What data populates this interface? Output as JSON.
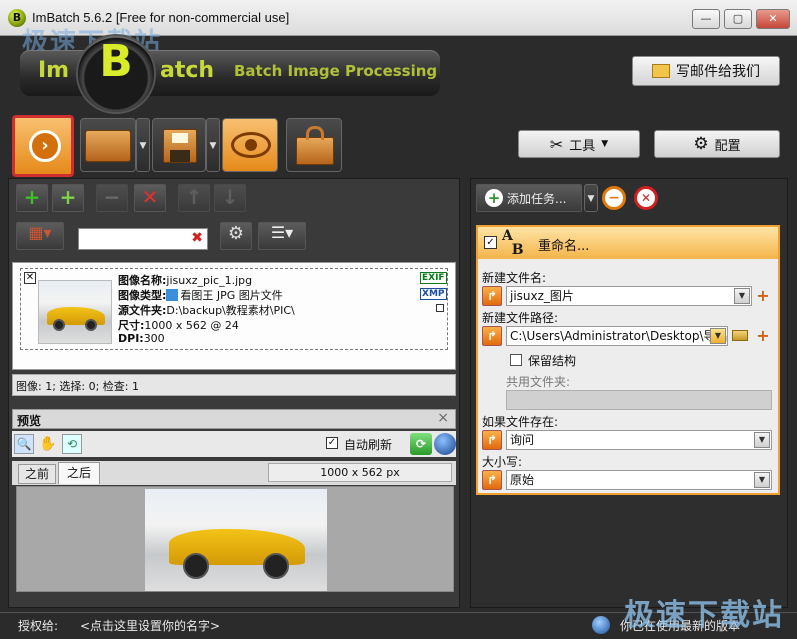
{
  "window": {
    "title": "ImBatch 5.6.2 [Free for non-commercial use]",
    "min": "—",
    "max": "▢",
    "close": "✕"
  },
  "logo": {
    "left": "Im",
    "center": "B",
    "right": "atch",
    "tagline": "Batch Image Processing"
  },
  "header": {
    "email_label": "写邮件给我们"
  },
  "toolbar": {
    "tools_label": "工具",
    "config_label": "配置"
  },
  "image": {
    "name_label": "图像名称:",
    "name_value": "jisuxz_pic_1.jpg",
    "type_label": "图像类型:",
    "type_value": "看图王 JPG 图片文件",
    "source_label": "源文件夹:",
    "source_value": "D:\\backup\\教程素材\\PIC\\",
    "size_label": "尺寸:",
    "size_value": "1000 x 562 @ 24",
    "dpi_label": "DPI:",
    "dpi_value": "300",
    "exif_badge": "EXIF",
    "xmp_badge": "XMP"
  },
  "status": {
    "text": "图像: 1; 选择: 0; 检查: 1"
  },
  "preview": {
    "title": "预览",
    "close": "×",
    "auto_refresh_label": "自动刷新",
    "auto_refresh_checked": true,
    "tab_before": "之前",
    "tab_after": "之后",
    "active_tab": "之后",
    "dimensions": "1000 x 562 px"
  },
  "tasks": {
    "add_label": "添加任务...",
    "task_title": "重命名...",
    "new_name_label": "新建文件名:",
    "new_name_value": "jisuxz_图片",
    "new_path_label": "新建文件路径:",
    "new_path_value": "C:\\Users\\Administrator\\Desktop\\导出",
    "keep_structure_label": "保留结构",
    "keep_structure_checked": false,
    "shared_folder_label": "共用文件夹:",
    "shared_folder_value": "",
    "if_exists_label": "如果文件存在:",
    "if_exists_value": "询问",
    "case_label": "大小写:",
    "case_value": "原始"
  },
  "footer": {
    "license_label": "授权给:",
    "license_value": "<点击这里设置你的名字>",
    "version_status": "你已在使用最新的版本"
  },
  "watermarks": {
    "top": "极速下载站",
    "bottom": "极速下载站"
  },
  "colors": {
    "accent_orange": "#f0a030",
    "logo_green": "#c7d93a",
    "highlight_red": "#d12f2f"
  }
}
